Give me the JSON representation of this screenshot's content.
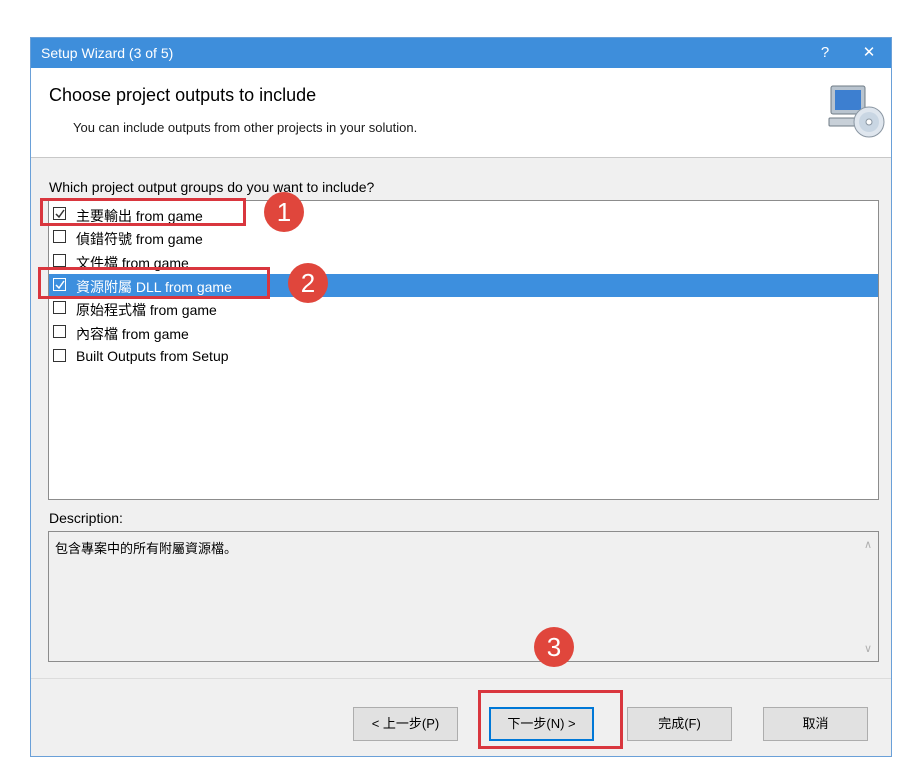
{
  "window": {
    "title": "Setup Wizard (3 of 5)",
    "help_label": "?",
    "close_label": "✕"
  },
  "header": {
    "title": "Choose project outputs to include",
    "subtitle": "You can include outputs from other projects in your solution.",
    "icon": "computer-cd-icon"
  },
  "question": "Which project output groups do you want to include?",
  "outputs": [
    {
      "label": "主要輸出 from game",
      "checked": true,
      "selected": false
    },
    {
      "label": "偵錯符號 from game",
      "checked": false,
      "selected": false
    },
    {
      "label": "文件檔 from game",
      "checked": false,
      "selected": false
    },
    {
      "label": "資源附屬 DLL from game",
      "checked": true,
      "selected": true
    },
    {
      "label": "原始程式檔 from game",
      "checked": false,
      "selected": false
    },
    {
      "label": "內容檔 from game",
      "checked": false,
      "selected": false
    },
    {
      "label": "Built Outputs from Setup",
      "checked": false,
      "selected": false
    }
  ],
  "description": {
    "label": "Description:",
    "text": "包含專案中的所有附屬資源檔。"
  },
  "buttons": {
    "back": "< 上一步(P)",
    "next": "下一步(N) >",
    "finish": "完成(F)",
    "cancel": "取消"
  },
  "annotations": {
    "badge1": "1",
    "badge2": "2",
    "badge3": "3",
    "color": "#e0463c"
  },
  "colors": {
    "titlebar": "#3e8edb",
    "selection": "#3d8fde"
  }
}
